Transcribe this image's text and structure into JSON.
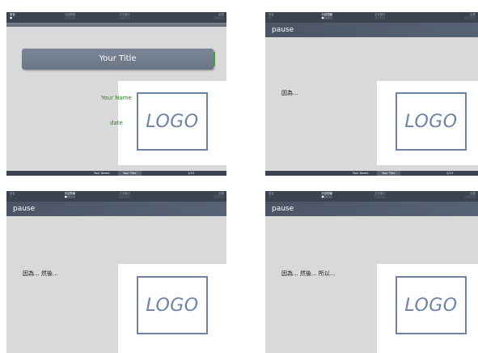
{
  "nav": {
    "sections": [
      "前言",
      "內容簡報",
      "文字顯示",
      "結尾"
    ],
    "slide1_dots": [
      "●",
      "○○○○",
      "○○○○",
      "○○○○"
    ],
    "dots": [
      "○",
      "●○○○",
      "○○○○",
      "○○○○"
    ]
  },
  "title_slide": {
    "title": "Your Title",
    "author": "Your Name",
    "date": "date"
  },
  "frame_title": "pause",
  "slides": [
    {
      "body": "",
      "page": "1/13"
    },
    {
      "body": "因為...",
      "page": "2/13"
    },
    {
      "body": "因為... 然後...",
      "page": ""
    },
    {
      "body": "因為... 然後... 所以...",
      "page": ""
    }
  ],
  "footer": {
    "author": "Your Name",
    "title": "Your Title"
  },
  "logo": {
    "text": "LOGO",
    "color": "#6d84a7"
  },
  "colors": {
    "navbar": "#3b4250",
    "title_band": "#4b5566",
    "slide_bg": "#d9d9d9",
    "accent_green": "#1f8a1f"
  }
}
